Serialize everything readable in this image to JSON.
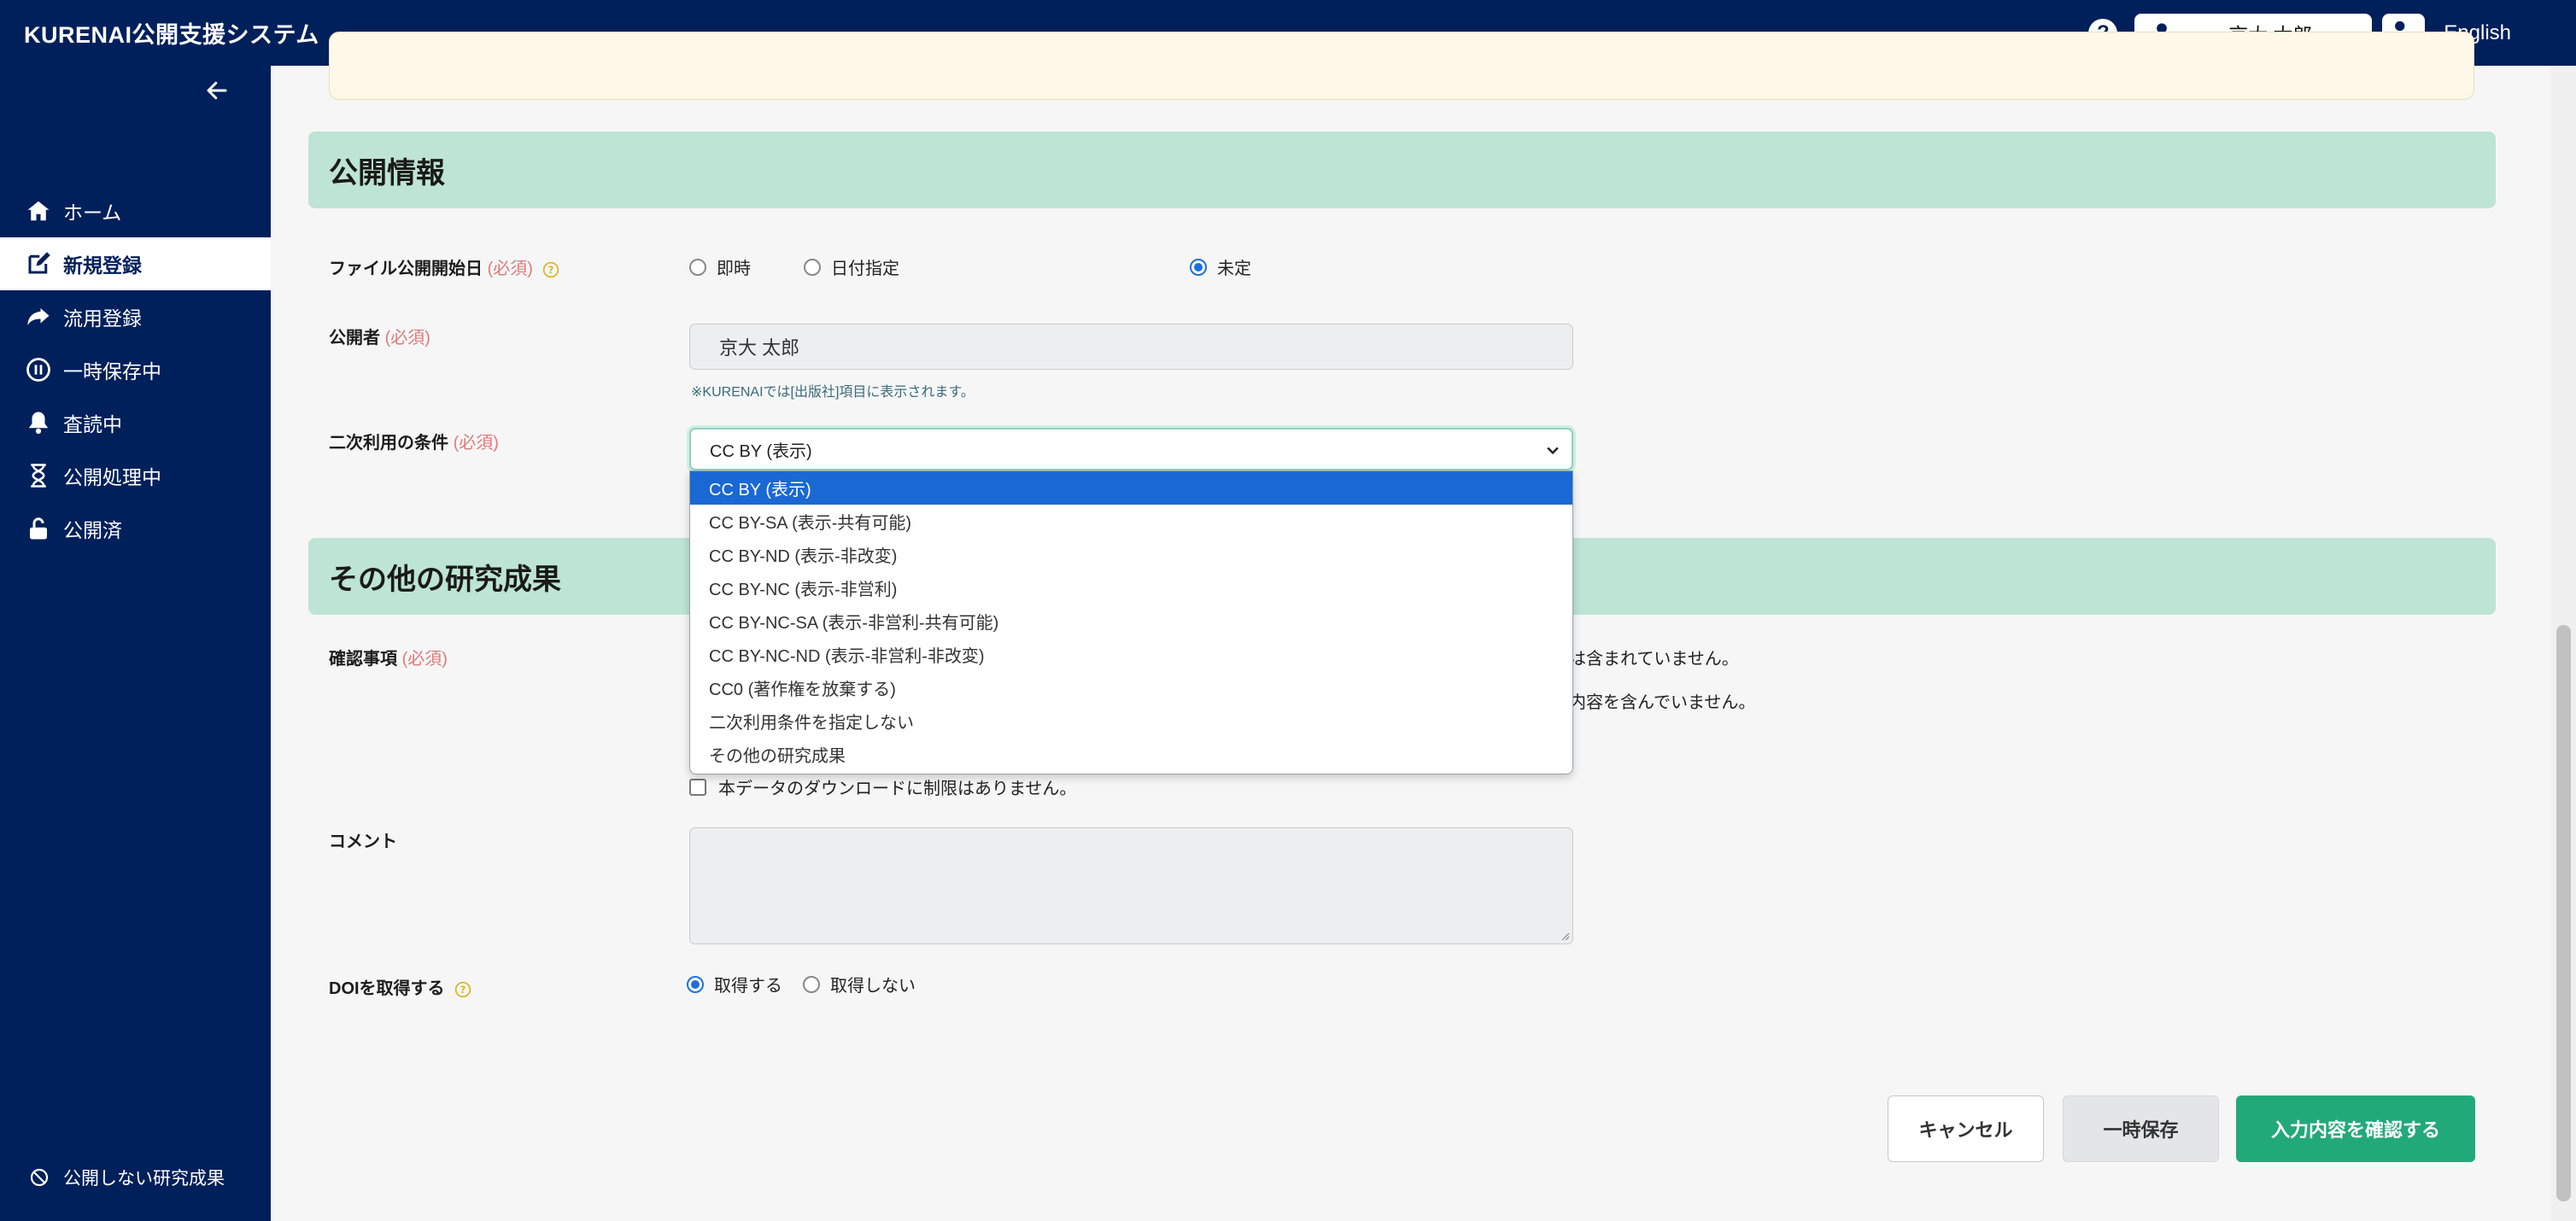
{
  "header": {
    "brand": "KURENAI公開支援システム",
    "help_icon": "question-circle-icon",
    "user_name": "京大 太郎",
    "language_link": "English"
  },
  "sidebar": {
    "items": [
      {
        "label": "ホーム",
        "icon": "home-icon"
      },
      {
        "label": "新規登録",
        "icon": "edit-icon",
        "active": true
      },
      {
        "label": "流用登録",
        "icon": "share-arrow-icon"
      },
      {
        "label": "一時保存中",
        "icon": "pause-circle-icon"
      },
      {
        "label": "査読中",
        "icon": "bell-icon"
      },
      {
        "label": "公開処理中",
        "icon": "hourglass-icon"
      },
      {
        "label": "公開済",
        "icon": "unlock-icon"
      }
    ],
    "bottom_item": "公開しない研究成果"
  },
  "sections": {
    "publication": "公開情報",
    "other": "その他の研究成果"
  },
  "form": {
    "required_mark": "(必須)",
    "file_release_label": "ファイル公開開始日",
    "file_release_options": [
      "即時",
      "日付指定",
      "未定"
    ],
    "file_release_selected": "未定",
    "publisher_label": "公開者",
    "publisher_value": "京大 太郎",
    "publisher_hint": "※KURENAIでは[出版社]項目に表示されます。",
    "license_label": "二次利用の条件",
    "license_value": "CC BY (表示)",
    "license_options": [
      "CC BY (表示)",
      "CC BY-SA (表示-共有可能)",
      "CC BY-ND (表示-非改変)",
      "CC BY-NC (表示-非営利)",
      "CC BY-NC-SA (表示-非営利-共有可能)",
      "CC BY-NC-ND (表示-非営利-非改変)",
      "CC0 (著作権を放棄する)",
      "二次利用条件を指定しない",
      "その他の研究成果"
    ],
    "confirm_label": "確認事項",
    "confirm_partial_1": "報は含まれていません。",
    "confirm_partial_2": "る内容を含んでいません。",
    "confirm_download": "本データのダウンロードに制限はありません。",
    "comment_label": "コメント",
    "doi_label": "DOIを取得する",
    "doi_options": [
      "取得する",
      "取得しない"
    ],
    "doi_selected": "取得する"
  },
  "buttons": {
    "cancel": "キャンセル",
    "draft": "一時保存",
    "confirm": "入力内容を確認する"
  },
  "colors": {
    "navy": "#00205b",
    "section_bg": "#bde4d5",
    "primary_green": "#22a97a",
    "dropdown_selected": "#1a68d4",
    "required": "#e07a7a"
  }
}
